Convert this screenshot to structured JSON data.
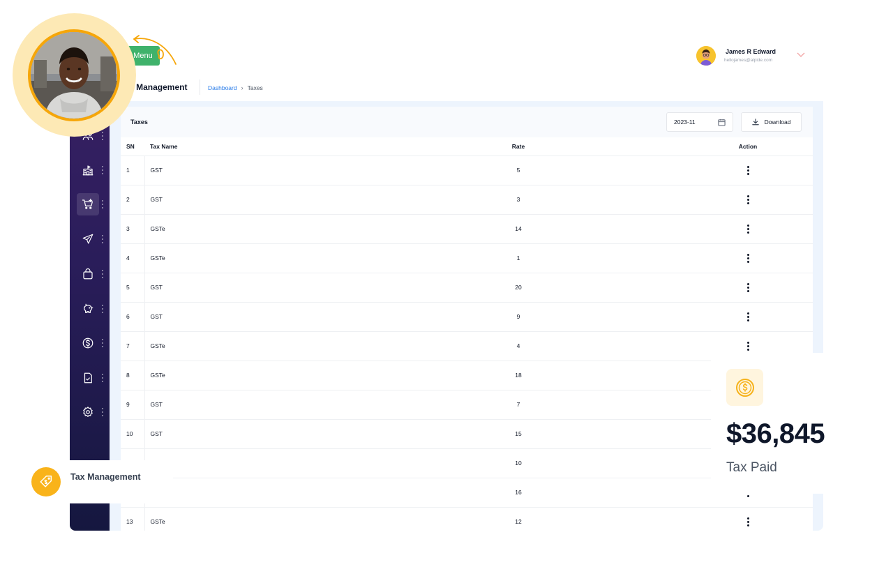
{
  "header": {
    "menu_label": "Menu",
    "page_title": "Tax Management",
    "breadcrumb": {
      "link": "Dashboard",
      "separator": "›",
      "current": "Taxes"
    }
  },
  "user": {
    "name": "James R Edward",
    "email": "hellojames@alpide.com"
  },
  "sidebar": {
    "items": [
      {
        "icon": "users-icon"
      },
      {
        "icon": "school-icon"
      },
      {
        "icon": "cart-plus-icon",
        "active": true
      },
      {
        "icon": "send-icon"
      },
      {
        "icon": "bag-icon"
      },
      {
        "icon": "piggy-bank-icon"
      },
      {
        "icon": "dollar-icon"
      },
      {
        "icon": "document-check-icon"
      },
      {
        "icon": "settings-icon"
      }
    ]
  },
  "card": {
    "title": "Taxes",
    "date_value": "2023-11",
    "download_label": "Download"
  },
  "table": {
    "columns": [
      "SN",
      "Tax Name",
      "Rate",
      "Action"
    ],
    "rows": [
      {
        "sn": "1",
        "name": "GST",
        "rate": "5"
      },
      {
        "sn": "2",
        "name": "GST",
        "rate": "3"
      },
      {
        "sn": "3",
        "name": "GSTe",
        "rate": "14"
      },
      {
        "sn": "4",
        "name": "GSTe",
        "rate": "1"
      },
      {
        "sn": "5",
        "name": "GST",
        "rate": "20"
      },
      {
        "sn": "6",
        "name": "GST",
        "rate": "9"
      },
      {
        "sn": "7",
        "name": "GSTe",
        "rate": "4"
      },
      {
        "sn": "8",
        "name": "GSTe",
        "rate": "18"
      },
      {
        "sn": "9",
        "name": "GST",
        "rate": "7"
      },
      {
        "sn": "10",
        "name": "GST",
        "rate": "15"
      },
      {
        "sn": "",
        "name": "",
        "rate": "10"
      },
      {
        "sn": "",
        "name": "",
        "rate": "16"
      },
      {
        "sn": "13",
        "name": "GSTe",
        "rate": "12"
      }
    ]
  },
  "stat": {
    "value": "$36,845",
    "label": "Tax Paid"
  },
  "badge": {
    "label": "Tax Management"
  },
  "colors": {
    "accent_green": "#3fb26b",
    "accent_orange": "#f6a609",
    "link_blue": "#2b7de9",
    "sidebar_top": "#3b2166",
    "sidebar_bottom": "#15173f"
  }
}
